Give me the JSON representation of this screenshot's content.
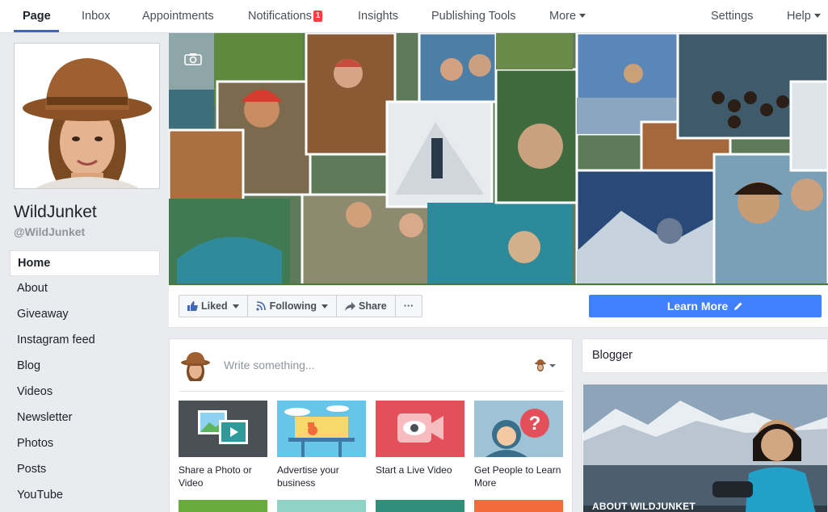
{
  "topnav": {
    "tabs": [
      {
        "label": "Page",
        "active": true
      },
      {
        "label": "Inbox"
      },
      {
        "label": "Appointments"
      },
      {
        "label": "Notifications",
        "badge": "1"
      },
      {
        "label": "Insights"
      },
      {
        "label": "Publishing Tools"
      },
      {
        "label": "More"
      },
      {
        "label": "Settings"
      },
      {
        "label": "Help"
      }
    ]
  },
  "profile": {
    "name": "WildJunket",
    "handle": "@WildJunket"
  },
  "sidebar": {
    "items": [
      {
        "label": "Home",
        "active": true
      },
      {
        "label": "About"
      },
      {
        "label": "Giveaway"
      },
      {
        "label": "Instagram feed"
      },
      {
        "label": "Blog"
      },
      {
        "label": "Videos"
      },
      {
        "label": "Newsletter"
      },
      {
        "label": "Photos"
      },
      {
        "label": "Posts"
      },
      {
        "label": "YouTube"
      }
    ]
  },
  "actions": {
    "liked": "Liked",
    "following": "Following",
    "share": "Share",
    "more": "···",
    "learn_more": "Learn More"
  },
  "composer": {
    "placeholder": "Write something...",
    "tiles": [
      {
        "label": "Share a Photo or Video"
      },
      {
        "label": "Advertise your business"
      },
      {
        "label": "Start a Live Video"
      },
      {
        "label": "Get People to Learn More"
      }
    ]
  },
  "right": {
    "category": "Blogger",
    "about_title": "ABOUT WILDJUNKET"
  },
  "colors": {
    "accent": "#4267b2",
    "button_blue": "#4080ff",
    "badge_red": "#fa3e3e",
    "page_bg": "#e9ebee"
  }
}
